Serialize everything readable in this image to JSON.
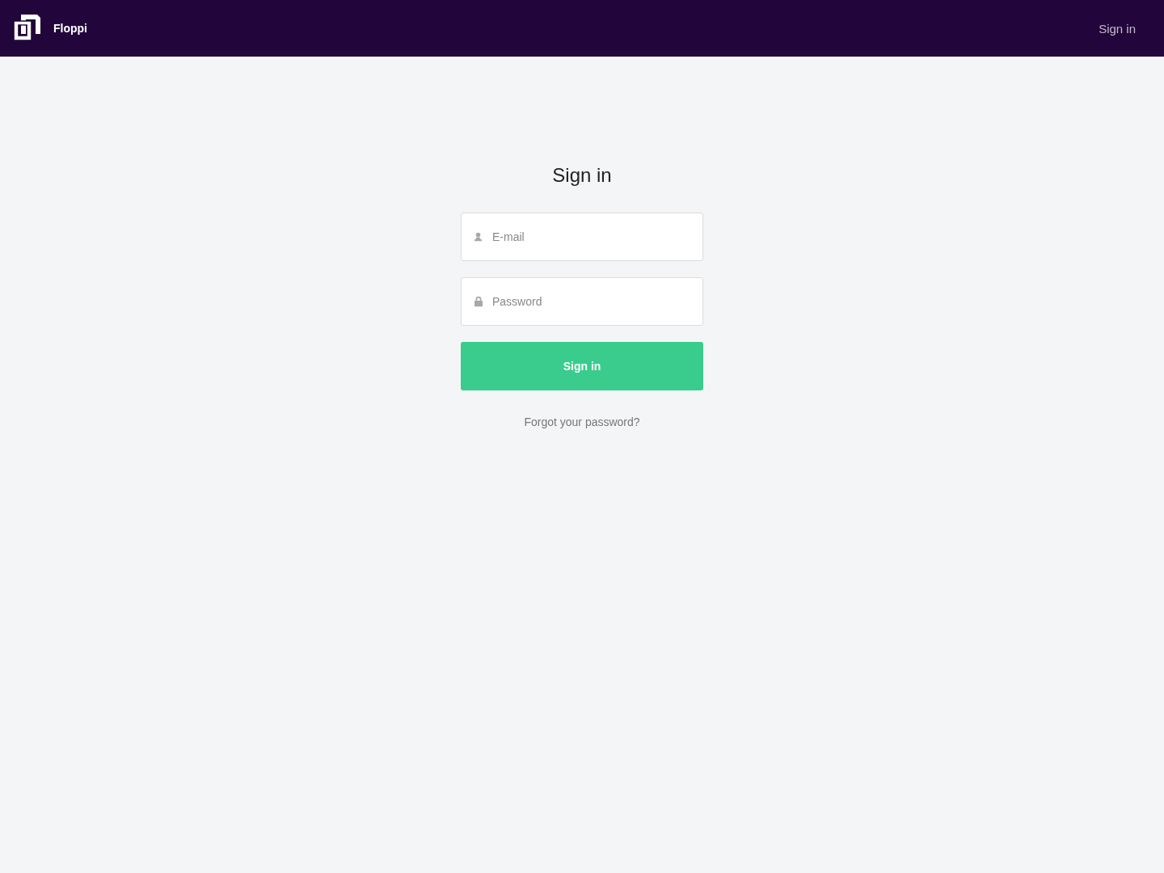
{
  "header": {
    "brand": "Floppi",
    "nav_link": "Sign in"
  },
  "form": {
    "title": "Sign in",
    "fields": [
      {
        "kind": "email",
        "placeholder": "E-mail"
      },
      {
        "kind": "password",
        "placeholder": "Password"
      }
    ],
    "submit": "Sign in",
    "forgot_link": "Forgot your password?"
  }
}
